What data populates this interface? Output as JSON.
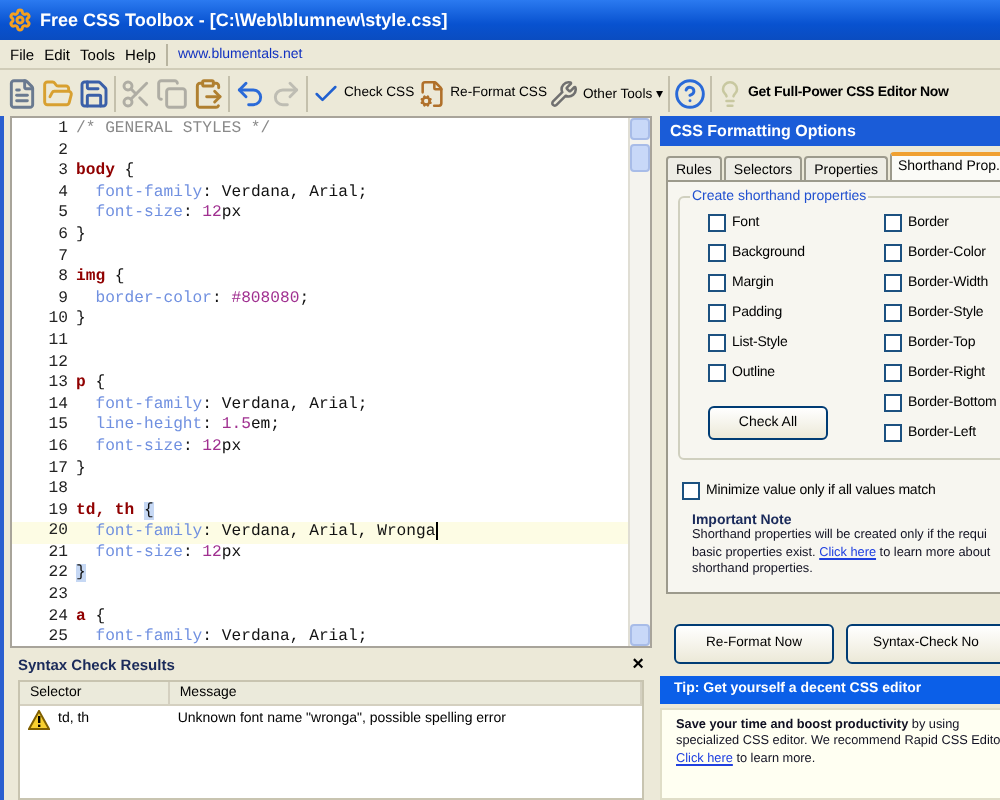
{
  "window": {
    "title": "Free CSS Toolbox - [C:\\Web\\blumnew\\style.css]"
  },
  "menu": [
    {
      "label": "File"
    },
    {
      "label": "Edit"
    },
    {
      "label": "Tools"
    },
    {
      "label": "Help"
    }
  ],
  "menu_link": "www.blumentals.net",
  "toolbar": [
    {
      "kind": "new",
      "disabled": false
    },
    {
      "kind": "open",
      "disabled": false
    },
    {
      "kind": "save",
      "disabled": false
    },
    {
      "kind": "sep"
    },
    {
      "kind": "cut",
      "disabled": true
    },
    {
      "kind": "copy",
      "disabled": true
    },
    {
      "kind": "paste",
      "disabled": false
    },
    {
      "kind": "sep"
    },
    {
      "kind": "undo",
      "disabled": false
    },
    {
      "kind": "redo",
      "disabled": true
    },
    {
      "kind": "sep"
    },
    {
      "kind": "check",
      "label": "Check CSS",
      "disabled": false
    },
    {
      "kind": "reformat",
      "label": "Re-Format CSS",
      "disabled": false
    },
    {
      "kind": "tools",
      "label": "Other Tools",
      "caret": "▾",
      "disabled": false
    },
    {
      "kind": "sep"
    },
    {
      "kind": "help",
      "disabled": false
    },
    {
      "kind": "sep"
    },
    {
      "kind": "bulb",
      "label": "Get Full-Power CSS Editor Now",
      "disabled": false
    }
  ],
  "editor": {
    "lines": [
      {
        "number": "1",
        "current": false,
        "tokens": [
          {
            "kind": "comment",
            "text": "/* GENERAL STYLES */"
          }
        ]
      },
      {
        "number": "2",
        "current": false
      },
      {
        "number": "3",
        "current": false,
        "tokens": [
          {
            "kind": "selector",
            "text": "body"
          },
          {
            "kind": "plain",
            "text": " {"
          }
        ]
      },
      {
        "number": "4",
        "current": false,
        "tokens": [
          {
            "kind": "property",
            "text": "  font-family"
          },
          {
            "kind": "plain",
            "text": ": Verdana, Arial;"
          }
        ]
      },
      {
        "number": "5",
        "current": false,
        "tokens": [
          {
            "kind": "property",
            "text": "  font-size"
          },
          {
            "kind": "plain",
            "text": ": "
          },
          {
            "kind": "number",
            "text": "12"
          },
          {
            "kind": "plain",
            "text": "px"
          }
        ]
      },
      {
        "number": "6",
        "current": false,
        "tokens": [
          {
            "kind": "plain",
            "text": "}"
          }
        ]
      },
      {
        "number": "7",
        "current": false
      },
      {
        "number": "8",
        "current": false,
        "tokens": [
          {
            "kind": "selector",
            "text": "img"
          },
          {
            "kind": "plain",
            "text": " {"
          }
        ]
      },
      {
        "number": "9",
        "current": false,
        "tokens": [
          {
            "kind": "property",
            "text": "  border-color"
          },
          {
            "kind": "plain",
            "text": ": "
          },
          {
            "kind": "number",
            "text": "#808080"
          },
          {
            "kind": "plain",
            "text": ";"
          }
        ]
      },
      {
        "number": "10",
        "current": false,
        "tokens": [
          {
            "kind": "plain",
            "text": "}"
          }
        ]
      },
      {
        "number": "11",
        "current": false
      },
      {
        "number": "12",
        "current": false
      },
      {
        "number": "13",
        "current": false,
        "tokens": [
          {
            "kind": "selector",
            "text": "p"
          },
          {
            "kind": "plain",
            "text": " {"
          }
        ]
      },
      {
        "number": "14",
        "current": false,
        "tokens": [
          {
            "kind": "property",
            "text": "  font-family"
          },
          {
            "kind": "plain",
            "text": ": Verdana, Arial;"
          }
        ]
      },
      {
        "number": "15",
        "current": false,
        "tokens": [
          {
            "kind": "property",
            "text": "  line-height"
          },
          {
            "kind": "plain",
            "text": ": "
          },
          {
            "kind": "number",
            "text": "1.5"
          },
          {
            "kind": "plain",
            "text": "em;"
          }
        ]
      },
      {
        "number": "16",
        "current": false,
        "tokens": [
          {
            "kind": "property",
            "text": "  font-size"
          },
          {
            "kind": "plain",
            "text": ": "
          },
          {
            "kind": "number",
            "text": "12"
          },
          {
            "kind": "plain",
            "text": "px"
          }
        ]
      },
      {
        "number": "17",
        "current": false,
        "tokens": [
          {
            "kind": "plain",
            "text": "}"
          }
        ]
      },
      {
        "number": "18",
        "current": false
      },
      {
        "number": "19",
        "current": false,
        "tokens": [
          {
            "kind": "selector",
            "text": "td, th"
          },
          {
            "kind": "brace-match",
            "text": "{"
          }
        ]
      },
      {
        "number": "20",
        "current": true,
        "tokens": [
          {
            "kind": "property",
            "text": "  font-family"
          },
          {
            "kind": "plain",
            "text": ": Verdana, Arial, Wronga"
          }
        ]
      },
      {
        "number": "21",
        "current": false,
        "tokens": [
          {
            "kind": "property",
            "text": "  font-size"
          },
          {
            "kind": "plain",
            "text": ": "
          },
          {
            "kind": "number",
            "text": "12"
          },
          {
            "kind": "plain",
            "text": "px"
          }
        ]
      },
      {
        "number": "22",
        "current": false,
        "tokens": [
          {
            "kind": "brace-match",
            "text": "}"
          }
        ]
      },
      {
        "number": "23",
        "current": false
      },
      {
        "number": "24",
        "current": false,
        "tokens": [
          {
            "kind": "selector",
            "text": "a"
          },
          {
            "kind": "plain",
            "text": " {"
          }
        ]
      },
      {
        "number": "25",
        "current": false,
        "tokens": [
          {
            "kind": "property",
            "text": "  font-family"
          },
          {
            "kind": "plain",
            "text": ": Verdana, Arial;"
          }
        ]
      }
    ]
  },
  "results": {
    "title": "Syntax Check Results",
    "close": "×",
    "columns": [
      "Selector",
      "Message"
    ],
    "rows": [
      {
        "kind": "warning",
        "selector": "td, th",
        "message": "Unknown font name \"wronga\", possible spelling error"
      }
    ]
  },
  "options": {
    "title": "CSS Formatting Options",
    "tabs": [
      {
        "label": "Rules",
        "selected": false
      },
      {
        "label": "Selectors",
        "selected": false
      },
      {
        "label": "Properties",
        "selected": false
      },
      {
        "label": "Shorthand Prop.",
        "selected": true
      }
    ],
    "group_title": "Create shorthand properties",
    "left_checks": [
      {
        "label": "Font",
        "checked": false
      },
      {
        "label": "Background",
        "checked": false
      },
      {
        "label": "Margin",
        "checked": false
      },
      {
        "label": "Padding",
        "checked": false
      },
      {
        "label": "List-Style",
        "checked": false
      },
      {
        "label": "Outline",
        "checked": false
      }
    ],
    "right_checks": [
      {
        "label": "Border",
        "checked": false
      },
      {
        "label": "Border-Color",
        "checked": false
      },
      {
        "label": "Border-Width",
        "checked": false
      },
      {
        "label": "Border-Style",
        "checked": false
      },
      {
        "label": "Border-Top",
        "checked": false
      },
      {
        "label": "Border-Right",
        "checked": false
      },
      {
        "label": "Border-Bottom",
        "checked": false
      },
      {
        "label": "Border-Left",
        "checked": false
      }
    ],
    "check_all": "Check All",
    "minimize": {
      "label": "Minimize value only if all values match",
      "checked": false
    },
    "note_title": "Important Note",
    "note_lines": [
      {
        "text": "Shorthand properties will be created only if the requi"
      },
      {
        "text": "basic properties exist. ",
        "link": "Click here",
        "after": " to learn more about"
      },
      {
        "text": "shorthand properties."
      }
    ],
    "buttons": [
      "Re-Format Now",
      "Syntax-Check No"
    ]
  },
  "tip": {
    "title": "Tip: Get yourself a decent CSS editor",
    "lines": [
      {
        "text": "**Save your time and boost productivity** by using"
      },
      {
        "text": "specialized CSS editor. We recommend Rapid CSS Edito"
      },
      {
        "link": "Click here",
        "after": " to learn more."
      }
    ]
  }
}
